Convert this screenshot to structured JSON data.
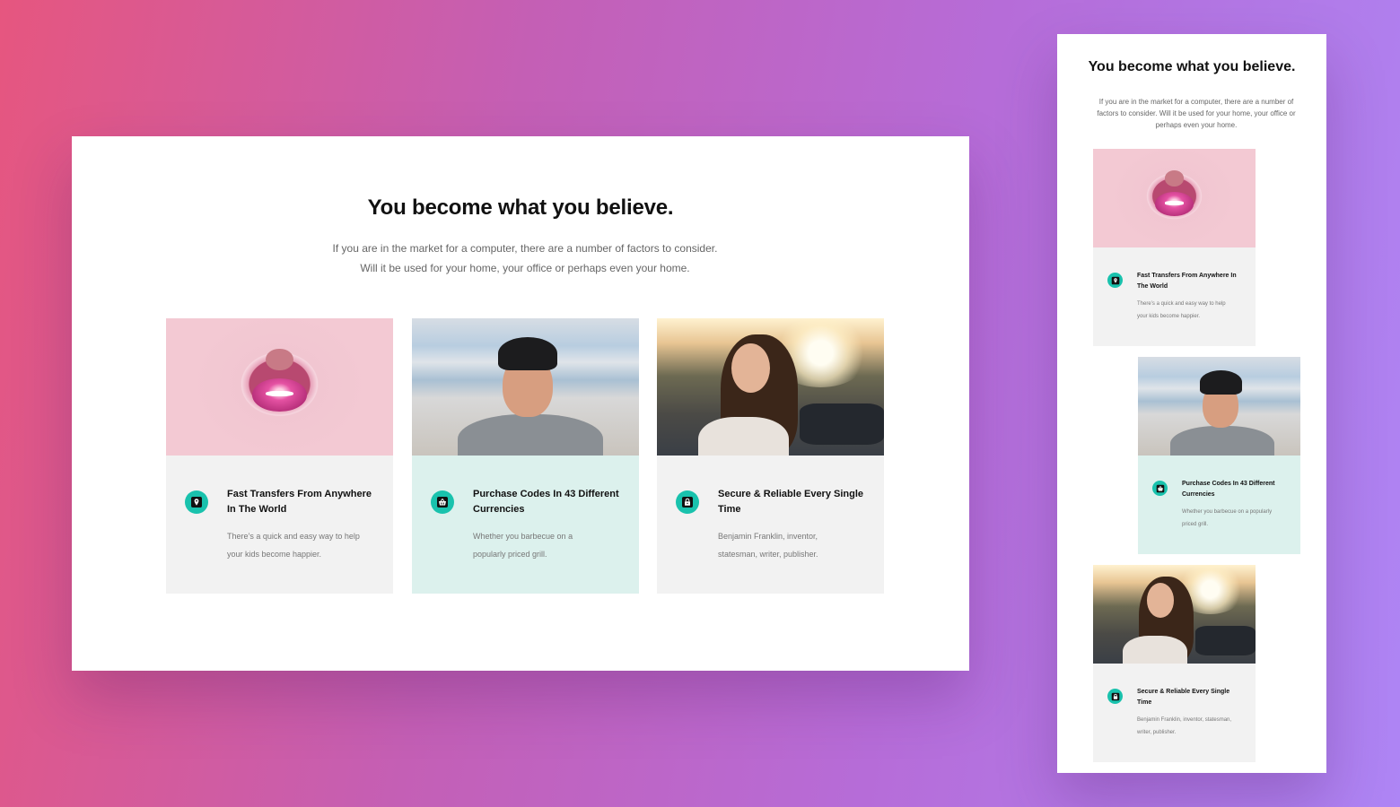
{
  "desktop": {
    "title": "You become what you believe.",
    "subtitle": "If you are in the market for a computer, there are a number of factors to consider. Will it be used for your home, your office or perhaps even your home.",
    "cards": [
      {
        "image": "woman-lips-through-torn-pink-paper",
        "icon": "map-pin-icon",
        "title": "Fast Transfers From Anywhere In The World",
        "text": "There’s a quick and easy way to help your kids become happier.",
        "bg": "#f2f2f2"
      },
      {
        "image": "young-man-in-black-beanie",
        "icon": "basket-icon",
        "title": "Purchase Codes In 43 Different Currencies",
        "text": "Whether you barbecue on a popularly priced grill.",
        "bg": "#dcf1ed"
      },
      {
        "image": "smiling-woman-heart-sunglasses",
        "icon": "lock-icon",
        "title": "Secure & Reliable Every Single Time",
        "text": "Benjamin Franklin, inventor, statesman, writer, publisher.",
        "bg": "#f2f2f2"
      }
    ]
  },
  "mobile": {
    "title": "You become what you believe.",
    "subtitle": "If you are in the market for a computer, there are a number of factors to consider. Will it be used for your home, your office or perhaps even your home.",
    "cards": [
      {
        "image": "woman-lips-through-torn-pink-paper",
        "icon": "map-pin-icon",
        "title": "Fast Transfers From Anywhere In The World",
        "text": "There’s a quick and easy way to help your kids become happier.",
        "bg": "#f2f2f2"
      },
      {
        "image": "young-man-in-black-beanie",
        "icon": "basket-icon",
        "title": "Purchase Codes In 43 Different Currencies",
        "text": "Whether you barbecue on a popularly priced grill.",
        "bg": "#dcf1ed"
      },
      {
        "image": "smiling-woman-heart-sunglasses",
        "icon": "lock-icon",
        "title": "Secure & Reliable Every Single Time",
        "text": "Benjamin Franklin, inventor, statesman, writer, publisher.",
        "bg": "#f2f2f2"
      }
    ]
  },
  "colors": {
    "accent": "#19c2ad",
    "card_gray": "#f2f2f2",
    "card_mint": "#dcf1ed",
    "background_start": "#e6567f",
    "background_end": "#ae85f5"
  }
}
